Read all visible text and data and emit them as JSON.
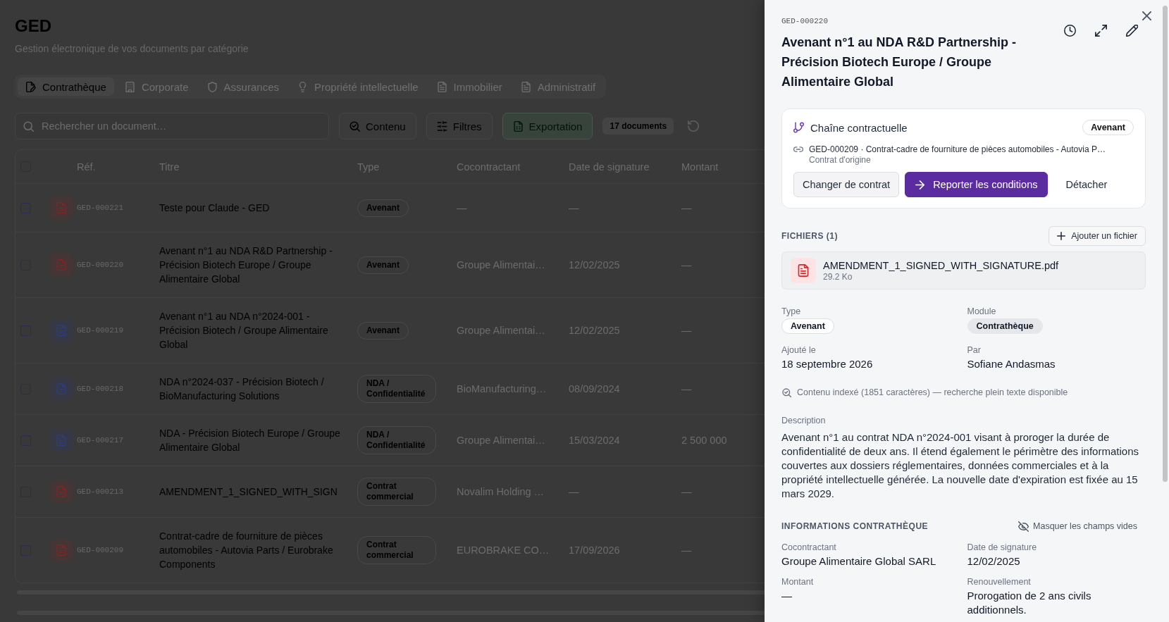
{
  "page": {
    "title": "GED",
    "subtitle": "Gestion électronique de vos documents par catégorie"
  },
  "tabs": [
    {
      "label": "Contrathèque",
      "selected": true
    },
    {
      "label": "Corporate",
      "selected": false
    },
    {
      "label": "Assurances",
      "selected": false
    },
    {
      "label": "Propriété intellectuelle",
      "selected": false
    },
    {
      "label": "Immobilier",
      "selected": false
    },
    {
      "label": "Administratif",
      "selected": false
    }
  ],
  "toolbar": {
    "search": {
      "placeholder": "Rechercher un document…"
    },
    "buttons": [
      {
        "label": "Contenu",
        "kind": "outline"
      },
      {
        "label": "Filtres",
        "kind": "outline"
      },
      {
        "label": "Exportation",
        "kind": "export"
      }
    ],
    "count": "17 documents"
  },
  "table": {
    "select_all": {
      "checked": false
    },
    "columns": [
      "Réf.",
      "Titre",
      "Type",
      "Cocontractant",
      "Date de signature",
      "Montant"
    ],
    "rows": [
      {
        "checked": false,
        "color": "#7a2727",
        "ref": "GED-000221",
        "title": "Teste pour Claude - GED",
        "type": "Avenant",
        "cocontractant": "—",
        "date": "—",
        "montant": "—"
      },
      {
        "checked": false,
        "color": "#7a2727",
        "ref": "GED-000220",
        "title": "Avenant n°1 au NDA R&D Partnership - Précision Biotech Europe / Groupe Alimentaire Global",
        "type": "Avenant",
        "cocontractant": "Groupe Alimentai…",
        "date": "12/02/2025",
        "montant": "—"
      },
      {
        "checked": false,
        "color": "#2e3d78",
        "ref": "GED-000219",
        "title": "Avenant n°1 au NDA n°2024-001 - Précision Biotech / Groupe Alimentaire Global",
        "type": "Avenant",
        "cocontractant": "Groupe Alimentai…",
        "date": "12/02/2025",
        "montant": "—"
      },
      {
        "checked": false,
        "color": "#2e3d78",
        "ref": "GED-000218",
        "title": "NDA n°2024-037 - Précision Biotech / BioManufacturing Solutions",
        "type": "NDA / Confidentialité",
        "cocontractant": "BioManufacturing…",
        "date": "08/09/2024",
        "montant": "—"
      },
      {
        "checked": false,
        "color": "#2e3d78",
        "ref": "GED-000217",
        "title": "NDA - Précision Biotech Europe / Groupe Alimentaire Global",
        "type": "NDA / Confidentialité",
        "cocontractant": "Groupe Alimentai…",
        "date": "15/03/2024",
        "montant": "2 500 000"
      },
      {
        "checked": false,
        "color": "#7a2727",
        "ref": "GED-000213",
        "title": "AMENDMENT_1_SIGNED_WITH_SIGN",
        "type": "Contrat commercial",
        "cocontractant": "Novalim Holding …",
        "date": "—",
        "montant": "—"
      },
      {
        "checked": false,
        "color": "#7a2727",
        "ref": "GED-000209",
        "title": "Contrat-cadre de fourniture de pièces automobiles - Autovia Parts / Eurobrake Components",
        "type": "Contrat commercial",
        "cocontractant": "EUROBRAKE CO…",
        "date": "17/09/2026",
        "montant": "—"
      }
    ]
  },
  "detail": {
    "ref": "GED-000220",
    "title": "Avenant n°1 au NDA R&D Partnership - Précision Biotech Europe / Groupe Alimentaire Global",
    "chain": {
      "title": "Chaîne contractuelle",
      "badge": "Avenant",
      "origin": "GED-000209 · Contrat-cadre de fourniture de pièces automobiles - Autovia P…",
      "origin_caption": "Contrat d'origine",
      "buttons": [
        {
          "label": "Changer de contrat",
          "kind": "secondary"
        },
        {
          "label": "Reporter les conditions",
          "kind": "primary"
        },
        {
          "label": "Détacher",
          "kind": "ghost"
        }
      ]
    },
    "files": {
      "heading": "FICHIERS (1)",
      "add_button": "Ajouter un fichier",
      "items": [
        {
          "name": "AMENDMENT_1_SIGNED_WITH_SIGNATURE.pdf",
          "size": "29.2 Ko"
        }
      ]
    },
    "meta": [
      {
        "label": "Type",
        "value": "Avenant",
        "kind": "pill"
      },
      {
        "label": "Module",
        "value": "Contrathèque",
        "kind": "tag"
      },
      {
        "label": "Ajouté le",
        "value": "18 septembre 2026",
        "kind": "text"
      },
      {
        "label": "Par",
        "value": "Sofiane Andasmas",
        "kind": "text"
      }
    ],
    "index_note": "Contenu indexé (1851 caractères) — recherche plein texte disponible",
    "description": {
      "label": "Description",
      "text": "Avenant n°1 au contrat NDA n°2024-001 visant à proroger la durée de confidentialité de deux ans. Il étend également le périmètre des informations couvertes aux dossiers réglementaires, données commerciales et à la propriété intellectuelle générée. La nouvelle date d'expiration est fixée au 15 mars 2029."
    },
    "info": {
      "heading": "INFORMATIONS CONTRATHÈQUE",
      "toggle": "Masquer les champs vides",
      "fields": [
        {
          "label": "Cocontractant",
          "value": "Groupe Alimentaire Global SARL"
        },
        {
          "label": "Date de signature",
          "value": "12/02/2025"
        },
        {
          "label": "Montant",
          "value": "—"
        },
        {
          "label": "Renouvellement",
          "value": "Prorogation de 2 ans civils additionnels."
        }
      ]
    }
  }
}
